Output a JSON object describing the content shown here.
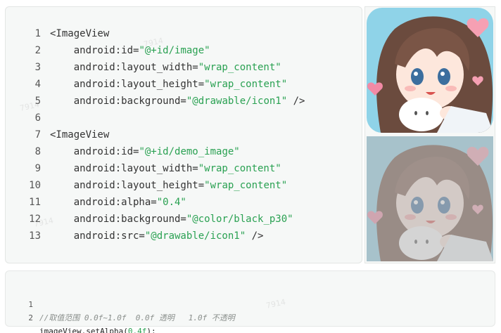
{
  "top_code": {
    "lines": [
      {
        "num": "1",
        "text": "<ImageView",
        "kind": "tag"
      },
      {
        "num": "2",
        "attr": "    android:id=",
        "val": "\"@+id/image\"",
        "tail": ""
      },
      {
        "num": "3",
        "attr": "    android:layout_width=",
        "val": "\"wrap_content\"",
        "tail": ""
      },
      {
        "num": "4",
        "attr": "    android:layout_height=",
        "val": "\"wrap_content\"",
        "tail": ""
      },
      {
        "num": "5",
        "attr": "    android:background=",
        "val": "\"@drawable/icon1\"",
        "tail": " />"
      },
      {
        "num": "6",
        "text": "",
        "kind": "blank"
      },
      {
        "num": "7",
        "text": "<ImageView",
        "kind": "tag"
      },
      {
        "num": "8",
        "attr": "    android:id=",
        "val": "\"@+id/demo_image\"",
        "tail": ""
      },
      {
        "num": "9",
        "attr": "    android:layout_width=",
        "val": "\"wrap_content\"",
        "tail": ""
      },
      {
        "num": "10",
        "attr": "    android:layout_height=",
        "val": "\"wrap_content\"",
        "tail": ""
      },
      {
        "num": "11",
        "attr": "    android:alpha=",
        "val": "\"0.4\"",
        "tail": ""
      },
      {
        "num": "12",
        "attr": "    android:background=",
        "val": "\"@color/black_p30\"",
        "tail": ""
      },
      {
        "num": "13",
        "attr": "    android:src=",
        "val": "\"@drawable/icon1\"",
        "tail": " />"
      }
    ]
  },
  "images": {
    "top": {
      "name": "anime-girl-icon-opaque",
      "alpha": 1.0
    },
    "bottom": {
      "name": "anime-girl-icon-alpha",
      "alpha": 0.4
    }
  },
  "bottom_code": {
    "line1": {
      "num": "1",
      "comment": "//取值范围 0.0f~1.0f  0.0f 透明   1.0f 不透明"
    },
    "line2": {
      "num": "2",
      "pre": "imageView.setAlpha(",
      "num_val": "0.4f",
      "post": ");"
    }
  },
  "watermarks": [
    "7914",
    "7914",
    "7914",
    "7914"
  ],
  "colors": {
    "panel_bg": "#f6f8f7",
    "string_green": "#2aa152",
    "comment_gray": "#8a8f8c"
  }
}
